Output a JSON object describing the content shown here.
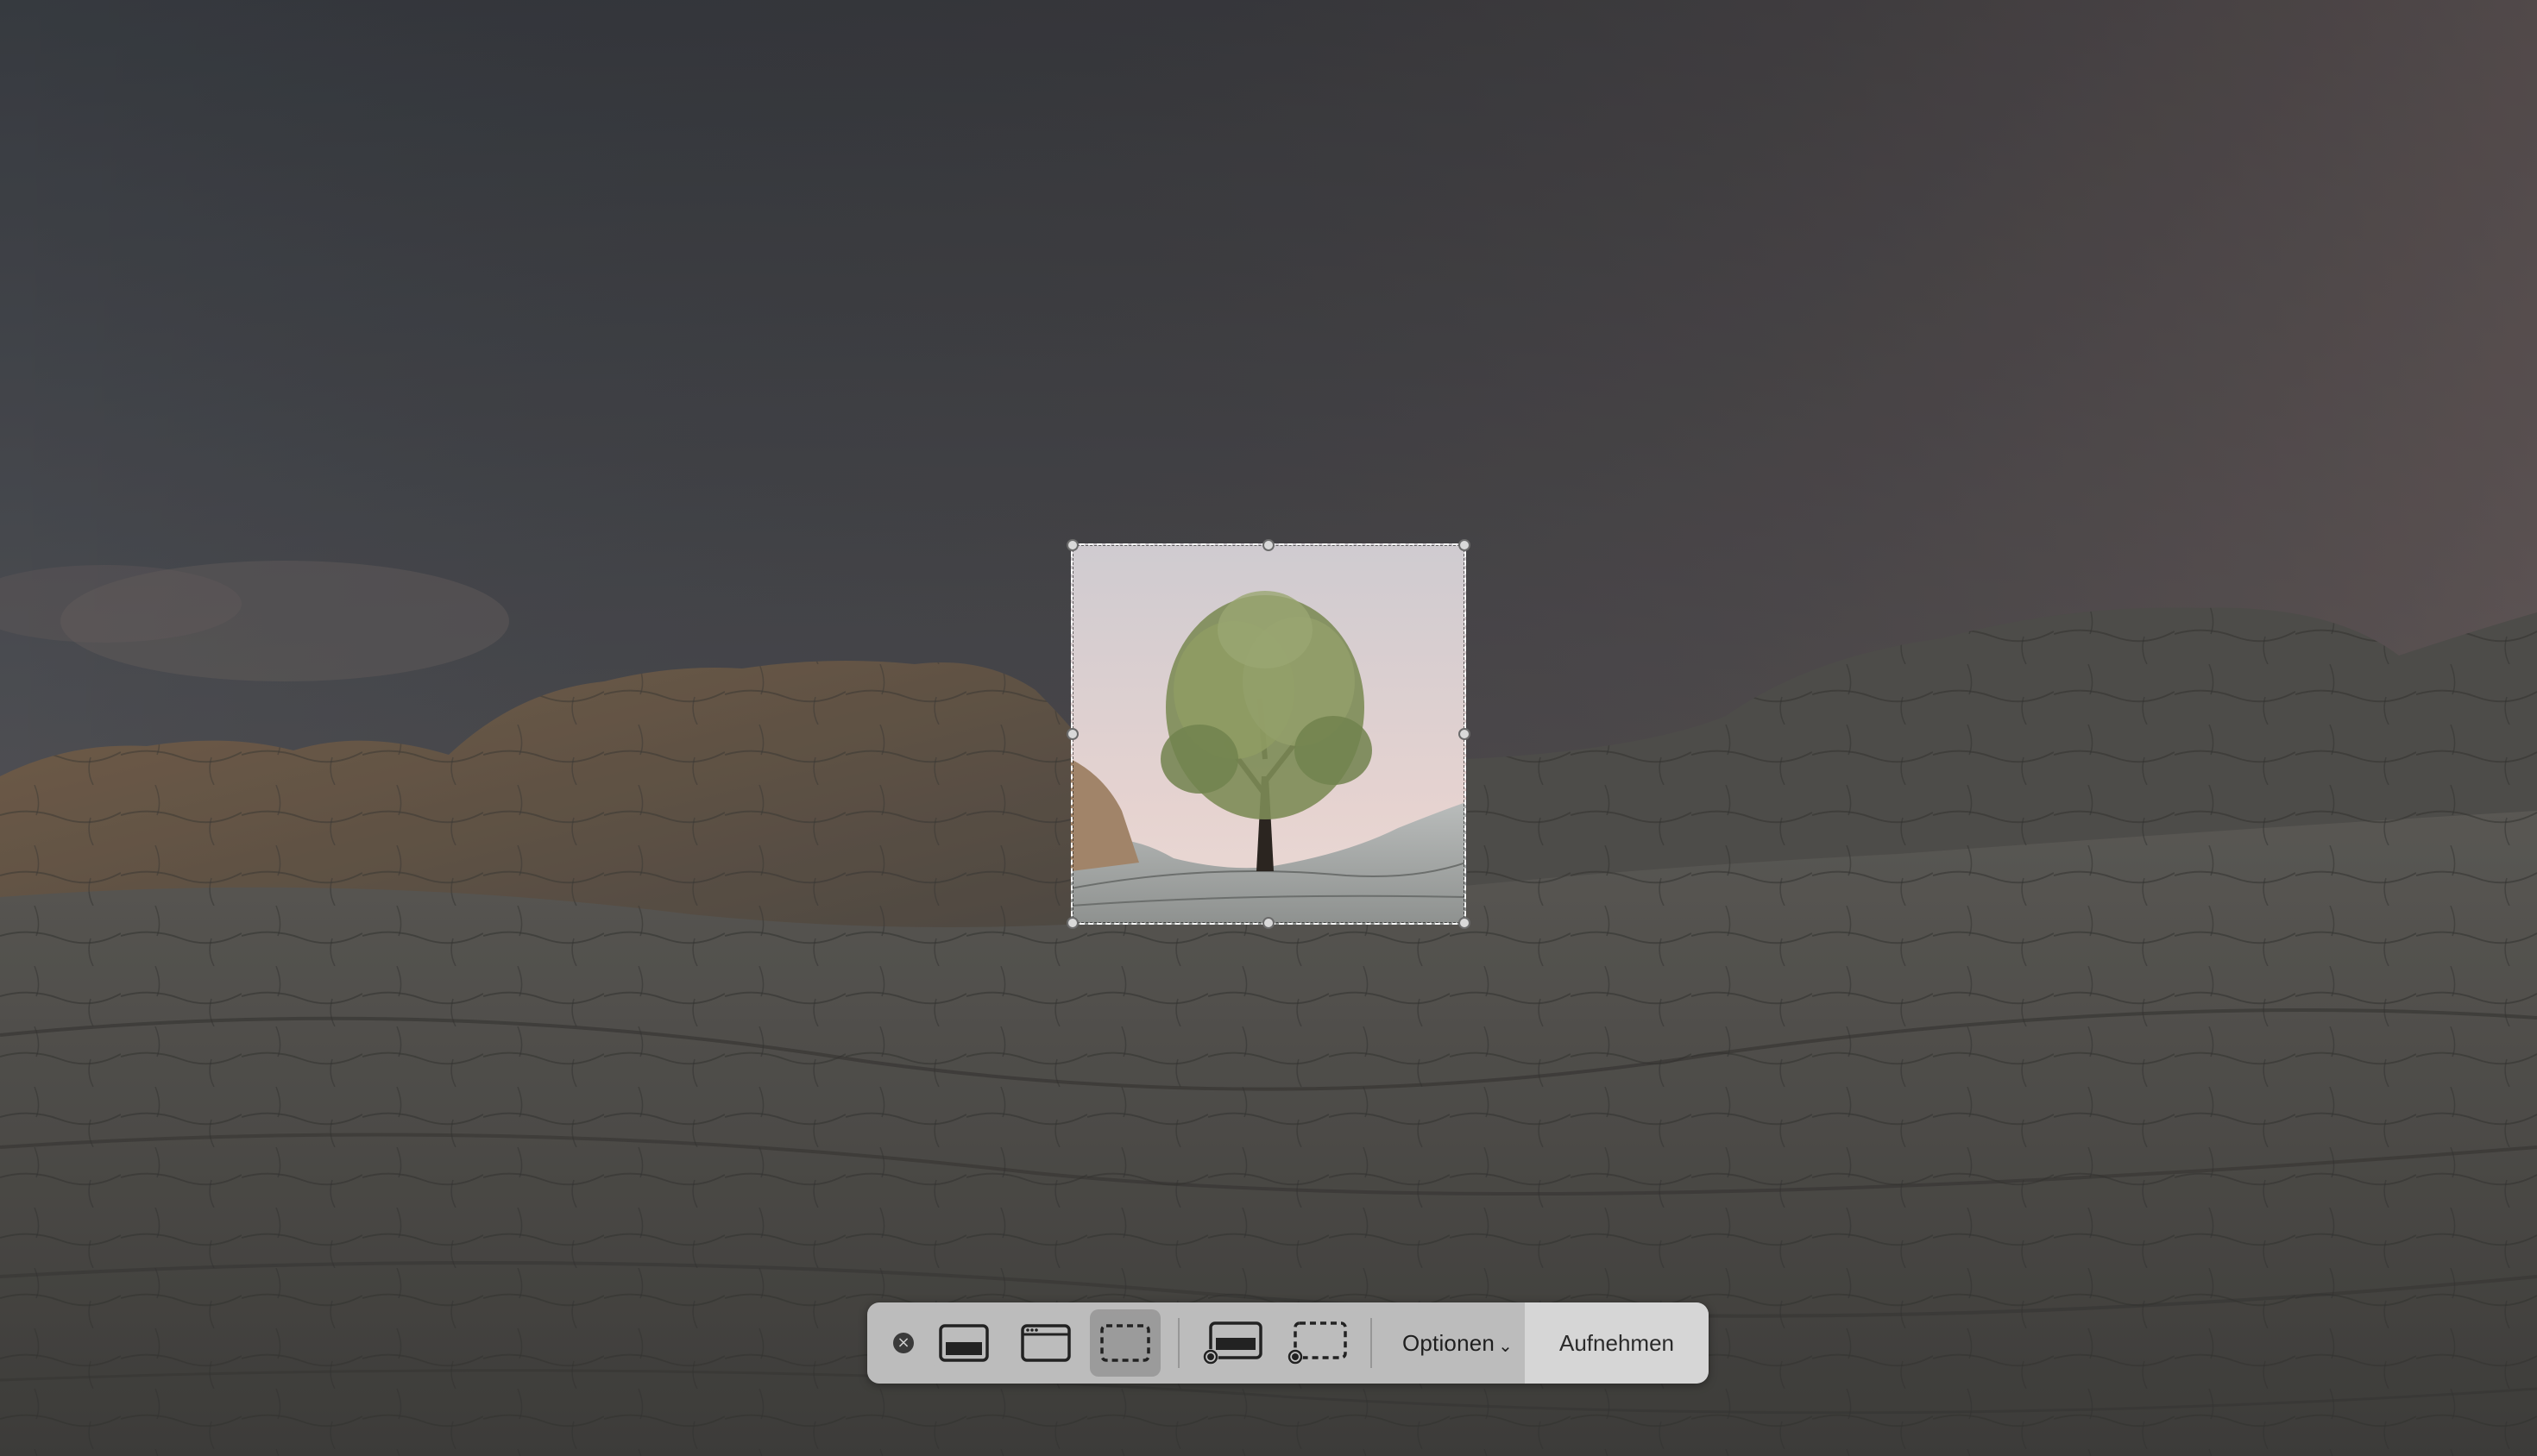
{
  "toolbar": {
    "close_icon": "close-icon",
    "modes": [
      {
        "name": "capture-entire-screen",
        "icon": "entire-screen-icon",
        "selected": false
      },
      {
        "name": "capture-selected-window",
        "icon": "window-icon",
        "selected": false
      },
      {
        "name": "capture-selected-portion",
        "icon": "selection-icon",
        "selected": true
      },
      {
        "name": "record-entire-screen",
        "icon": "record-screen-icon",
        "selected": false
      },
      {
        "name": "record-selected-portion",
        "icon": "record-selection-icon",
        "selected": false
      }
    ],
    "options_label": "Optionen",
    "options_chevron": "⌄",
    "capture_label": "Aufnehmen"
  },
  "colors": {
    "toolbar_bg": "#c6c6c6",
    "selected_mode_bg": "#8e8e8e",
    "selection_border": "#ffffff",
    "handle_fill": "#d9d9d9"
  }
}
